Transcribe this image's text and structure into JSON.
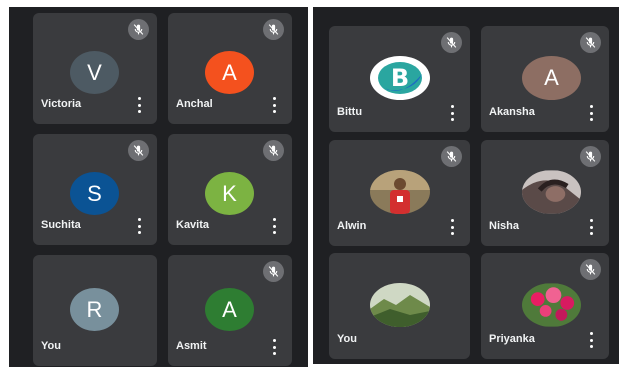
{
  "left_grid": {
    "tiles": [
      {
        "name": "Victoria",
        "initial": "V",
        "color": "#4d5a63",
        "muted": true,
        "menu": true
      },
      {
        "name": "Anchal",
        "initial": "A",
        "color": "#f4511e",
        "muted": true,
        "menu": true
      },
      {
        "name": "Suchita",
        "initial": "S",
        "color": "#0b5394",
        "muted": true,
        "menu": true
      },
      {
        "name": "Kavita",
        "initial": "K",
        "color": "#7cb342",
        "muted": true,
        "menu": true
      },
      {
        "name": "You",
        "initial": "R",
        "color": "#78909c",
        "muted": false,
        "menu": false
      },
      {
        "name": "Asmit",
        "initial": "A",
        "color": "#2e7d32",
        "muted": true,
        "menu": true
      }
    ]
  },
  "right_grid": {
    "tiles": [
      {
        "name": "Bittu",
        "avatar": "logo-b",
        "muted": true,
        "menu": true
      },
      {
        "name": "Akansha",
        "initial": "A",
        "color": "#8d6e63",
        "muted": true,
        "menu": true
      },
      {
        "name": "Alwin",
        "avatar": "photo-person",
        "muted": true,
        "menu": true
      },
      {
        "name": "Nisha",
        "avatar": "photo-nisha",
        "muted": true,
        "menu": true
      },
      {
        "name": "You",
        "avatar": "photo-landscape",
        "muted": false,
        "menu": false
      },
      {
        "name": "Priyanka",
        "avatar": "photo-flowers",
        "muted": true,
        "menu": true
      }
    ]
  },
  "icons": {
    "muted": "mic-off-icon",
    "menu": "more-vert-icon"
  }
}
